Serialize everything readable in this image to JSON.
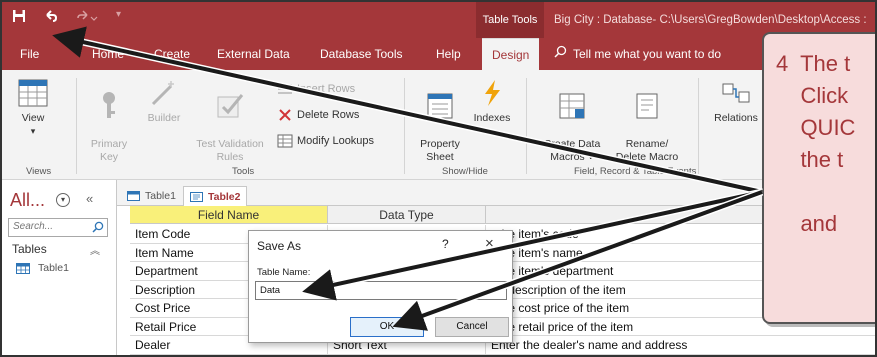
{
  "titlebar": {
    "table_tools": "Table Tools",
    "doc_title": "Big City : Database- C:\\Users\\GregBowden\\Desktop\\Access :"
  },
  "tabs": [
    {
      "label": "File"
    },
    {
      "label": "Home"
    },
    {
      "label": "Create"
    },
    {
      "label": "External Data"
    },
    {
      "label": "Database Tools"
    },
    {
      "label": "Help"
    },
    {
      "label": "Design"
    }
  ],
  "tell_me": "Tell me what you want to do",
  "ribbon": {
    "view": "View",
    "primary_key": "Primary\nKey",
    "builder": "Builder",
    "test_validation": "Test Validation\nRules",
    "insert_rows": "Insert Rows",
    "delete_rows": "Delete Rows",
    "modify_lookups": "Modify Lookups",
    "property_sheet": "Property\nSheet",
    "indexes": "Indexes",
    "create_data_macros": "Create Data\nMacros ˅",
    "rename_delete_macro": "Rename/\nDelete Macro",
    "relationships": "Relations",
    "groups": {
      "views": "Views",
      "tools": "Tools",
      "show_hide": "Show/Hide",
      "field_record": "Field, Record & Table Events"
    }
  },
  "nav": {
    "header": "All...",
    "search_placeholder": "Search...",
    "group": "Tables",
    "item": "Table1"
  },
  "doc_tabs": [
    "Table1",
    "Table2"
  ],
  "grid": {
    "headers": [
      "Field Name",
      "Data Type"
    ],
    "rows": [
      {
        "field": "Item Code",
        "type": "",
        "desc": "r the item's code"
      },
      {
        "field": "Item Name",
        "type": "",
        "desc": "r the item's name"
      },
      {
        "field": "Department",
        "type": "",
        "desc": "r the item's department"
      },
      {
        "field": "Description",
        "type": "",
        "desc": "r a description of the item"
      },
      {
        "field": "Cost Price",
        "type": "",
        "desc": "r the cost price of the item"
      },
      {
        "field": "Retail Price",
        "type": "",
        "desc": "r the retail price of the item"
      },
      {
        "field": "Dealer",
        "type": "Short Text",
        "desc": "Enter the dealer's name and address"
      }
    ]
  },
  "dialog": {
    "title": "Save As",
    "help": "?",
    "close": "×",
    "label": "Table Name:",
    "value": "Data",
    "ok": "OK",
    "cancel": "Cancel"
  },
  "callout": {
    "text": "4  The t\n    Click\n    QUIC\n    the t\n\n    and"
  },
  "colors": {
    "access_red": "#a4373a",
    "callout_bg": "#f7dcdc",
    "field_header": "#f9f07a"
  }
}
